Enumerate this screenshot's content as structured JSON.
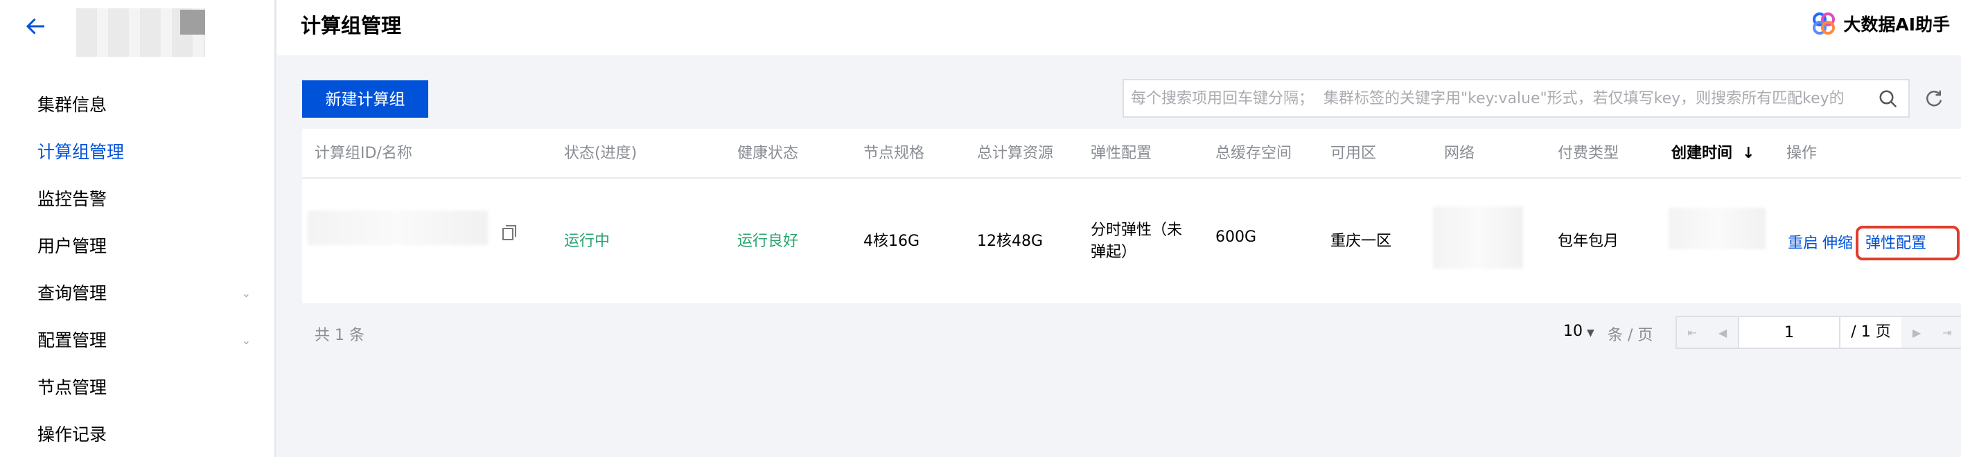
{
  "sidebar": {
    "items": [
      {
        "label": "集群信息",
        "active": false,
        "expandable": false
      },
      {
        "label": "计算组管理",
        "active": true,
        "expandable": false
      },
      {
        "label": "监控告警",
        "active": false,
        "expandable": false
      },
      {
        "label": "用户管理",
        "active": false,
        "expandable": false
      },
      {
        "label": "查询管理",
        "active": false,
        "expandable": true
      },
      {
        "label": "配置管理",
        "active": false,
        "expandable": true
      },
      {
        "label": "节点管理",
        "active": false,
        "expandable": false
      },
      {
        "label": "操作记录",
        "active": false,
        "expandable": false
      }
    ]
  },
  "header": {
    "title": "计算组管理",
    "ai_assistant": "大数据AI助手"
  },
  "toolbar": {
    "new_button": "新建计算组",
    "search_placeholder": "每个搜索项用回车键分隔；  集群标签的关键字用\"key:value\"形式，若仅填写key，则搜索所有匹配key的"
  },
  "table": {
    "columns": [
      "计算组ID/名称",
      "状态(进度)",
      "健康状态",
      "节点规格",
      "总计算资源",
      "弹性配置",
      "总缓存空间",
      "可用区",
      "网络",
      "付费类型",
      "创建时间",
      "操作"
    ],
    "rows": [
      {
        "status": "运行中",
        "health": "运行良好",
        "node_spec": "4核16G",
        "total_compute": "12核48G",
        "elastic_line1": "分时弹性（未",
        "elastic_line2": "弹起）",
        "cache": "600G",
        "zone": "重庆一区",
        "payment": "包年包月",
        "actions": [
          "重启",
          "伸缩",
          "弹性配置"
        ]
      }
    ]
  },
  "footer": {
    "total": "共 1 条",
    "page_size": "10",
    "per_page": "条 / 页",
    "current_page": "1",
    "total_pages": "/ 1 页"
  },
  "colors": {
    "primary": "#0052d9",
    "success": "#2ba471",
    "highlight": "#e23c2c"
  }
}
